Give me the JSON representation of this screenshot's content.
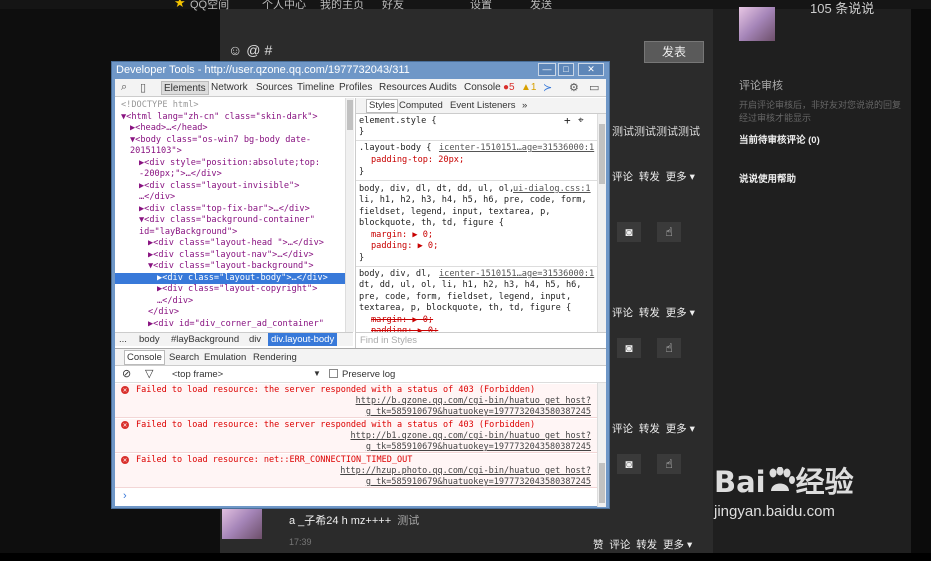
{
  "topbar": {
    "items": [
      "QQ空间",
      "个人中心",
      "我的主页",
      "好友",
      "设置",
      "发送"
    ]
  },
  "page": {
    "post_button": "发表",
    "emoji_icons": "☺@#",
    "profile_count": "105 条说说",
    "right_panel": {
      "title": "评论审核",
      "desc": "开启评论审核后，非好友对您说说的回复经过审核才能显示",
      "pending": "当前待审核评论 (0)",
      "help": "说说使用帮助"
    },
    "post_snippet": "测试测试测试测试",
    "action_row": [
      "评论",
      "转发",
      "更多 ▾"
    ],
    "action_row_last": [
      "赞",
      "评论",
      "转发",
      "更多 ▾"
    ],
    "last_post": {
      "author": "a _子希24 h mz++++",
      "text": "测试",
      "time": "17:39"
    }
  },
  "devtools": {
    "title": "Developer Tools - http://user.qzone.qq.com/1977732043/311",
    "window_buttons": [
      "—",
      "□",
      "✕"
    ],
    "tabs": [
      "Elements",
      "Network",
      "Sources",
      "Timeline",
      "Profiles",
      "Resources",
      "Audits",
      "Console"
    ],
    "error_count": "5",
    "warn_count": "1",
    "dom_lines": [
      {
        "indent": 0,
        "html": "<!DOCTYPE html>"
      },
      {
        "indent": 0,
        "html": "▼<html lang=\"zh-cn\" class=\"skin-dark\">"
      },
      {
        "indent": 1,
        "html": "▶<head>…</head>"
      },
      {
        "indent": 1,
        "html": "▼<body class=\"os-win7 bg-body  date-"
      },
      {
        "indent": 1,
        "html": "20151103\">"
      },
      {
        "indent": 2,
        "html": "▶<div style=\"position:absolute;top:"
      },
      {
        "indent": 2,
        "html": "-200px;\">…</div>"
      },
      {
        "indent": 2,
        "html": "▶<div class=\"layout-invisible\">"
      },
      {
        "indent": 2,
        "html": "…</div>"
      },
      {
        "indent": 2,
        "html": "▶<div class=\"top-fix-bar\">…</div>"
      },
      {
        "indent": 2,
        "html": "▼<div class=\"background-container\""
      },
      {
        "indent": 2,
        "html": "id=\"layBackground\">"
      },
      {
        "indent": 3,
        "html": "▶<div class=\"layout-head \">…</div>"
      },
      {
        "indent": 3,
        "html": "▶<div class=\"layout-nav\">…</div>"
      },
      {
        "indent": 3,
        "html": "▼<div class=\"layout-background\">"
      },
      {
        "indent": 4,
        "html": "▶<div class=\"layout-body\">…</div>",
        "selected": true
      },
      {
        "indent": 4,
        "html": "▶<div class=\"layout-copyright\">"
      },
      {
        "indent": 4,
        "html": "…</div>"
      },
      {
        "indent": 3,
        "html": "</div>"
      },
      {
        "indent": 3,
        "html": "▶<div id=\"div_corner_ad_container\""
      }
    ],
    "breadcrumbs": [
      "...",
      "body",
      "#layBackground",
      "div",
      "div.layout-body"
    ],
    "styles_tabs": [
      "Styles",
      "Computed",
      "Event Listeners",
      "»"
    ],
    "styles": {
      "element_style": "element.style {",
      "rule1_selector": ".layout-body {",
      "rule1_source": "icenter-1510151…age=31536000:1",
      "rule1_prop": "padding-top: 20px;",
      "rule2_selector_lines": [
        "body, div, dl, dt, dd, ul, ol,",
        "li, h1, h2, h3, h4, h5, h6, pre, code, form,",
        "fieldset, legend, input, textarea, p,",
        "blockquote, th, td, figure {"
      ],
      "rule2_source": "ui-dialog.css:1",
      "rule2_props": [
        "margin: ▶ 0;",
        "padding: ▶ 0;"
      ],
      "rule3_selector_lines": [
        "body, div, dl,",
        "dt, dd, ul, ol, li, h1, h2, h3, h4, h5, h6,",
        "pre, code, form, fieldset, legend, input,",
        "textarea, p, blockquote, th, td, figure {"
      ],
      "rule3_source": "icenter-1510151…age=31536000:1",
      "rule3_props": [
        "margin: ▶ 0;",
        "padding: ▶ 0;"
      ],
      "close": "}",
      "find_placeholder": "Find in Styles"
    },
    "console_tabs": [
      "Console",
      "Search",
      "Emulation",
      "Rendering"
    ],
    "frame_select": "<top frame>",
    "preserve_log": "Preserve log",
    "messages": [
      {
        "text": "Failed to load resource: the server responded with a status of 403 (Forbidden)",
        "url1": "http://b.qzone.qq.com/cgi-bin/huatuo_get_host?",
        "url2": "g_tk=585910679&huatuokey=1977732043580387245"
      },
      {
        "text": "Failed to load resource: the server responded with a status of 403 (Forbidden)",
        "url1": "http://b1.qzone.qq.com/cgi-bin/huatuo_get_host?",
        "url2": "g_tk=585910679&huatuokey=1977732043580387245"
      },
      {
        "text": "Failed to load resource: net::ERR_CONNECTION_TIMED_OUT",
        "url1": "http://hzup.photo.qq.com/cgi-bin/huatuo_get_host?",
        "url2": "g_tk=585910679&huatuokey=1977732043580387245"
      }
    ],
    "prompt": "›"
  },
  "watermark": {
    "logo_left": "Bai",
    "logo_right": "经验",
    "url": "jingyan.baidu.com"
  },
  "colors": {
    "accent": "#3879d9",
    "title_bar": "#6f97c7",
    "error": "#d9302c"
  }
}
